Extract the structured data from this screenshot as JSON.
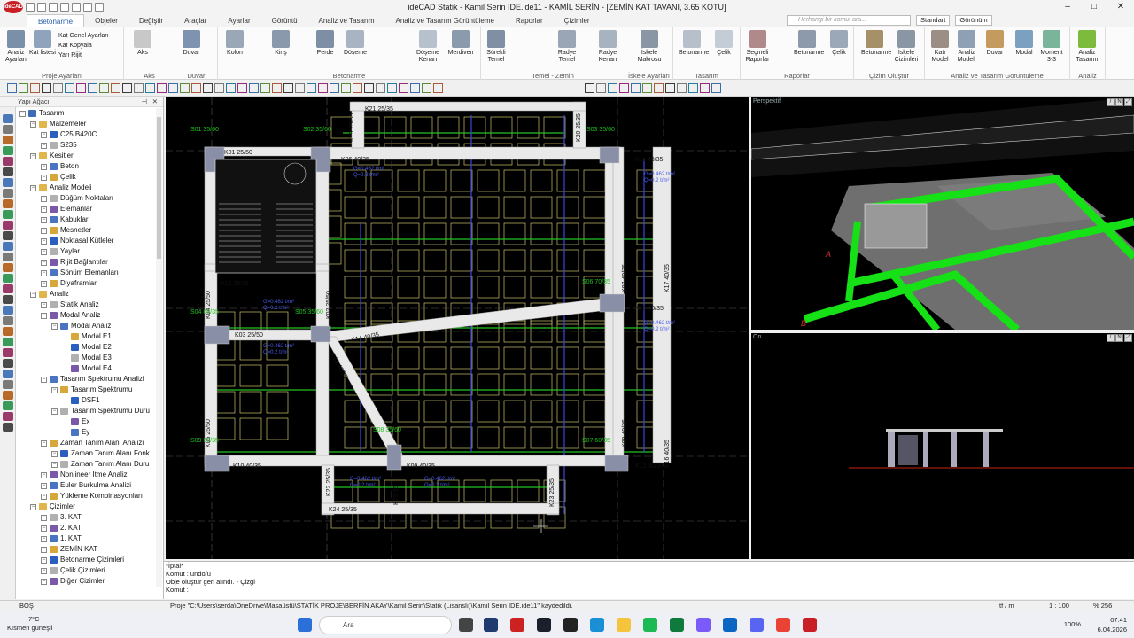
{
  "app": {
    "title": "ideCAD Statik - Kamil Serin IDE.ide11 - KAMİL SERİN - [ZEMİN KAT TAVANI,  3.65 KOTU]",
    "logo": "ideCAD"
  },
  "tabs": [
    "Betonarme",
    "Objeler",
    "Değiştir",
    "Araçlar",
    "Ayarlar",
    "Görüntü",
    "Analiz ve Tasarım",
    "Analiz ve Tasarım Görüntüleme",
    "Raporlar",
    "Çizimler"
  ],
  "command_search": {
    "placeholder": "Herhangi bir komut ara..."
  },
  "tab_right": {
    "standard": "Standart",
    "view": "Görünüm"
  },
  "ribbon": {
    "groups": [
      {
        "label": "Proje Ayarları"
      },
      {
        "label": "Aks"
      },
      {
        "label": "Duvar"
      },
      {
        "label": "Betonarme"
      },
      {
        "label": "Temel - Zemin"
      },
      {
        "label": "İskele Ayarları"
      },
      {
        "label": "Tasarım"
      },
      {
        "label": "Raporlar"
      },
      {
        "label": "Çizim Oluştur"
      },
      {
        "label": "Analiz ve Tasarım Görüntüleme"
      },
      {
        "label": "Analiz"
      }
    ],
    "buttons": [
      {
        "label": "Analiz Ayarları"
      },
      {
        "label": "Kat listesi"
      },
      {
        "label": "Aks"
      },
      {
        "label": "Duvar"
      },
      {
        "label": "Kolon"
      },
      {
        "label": "Kiriş"
      },
      {
        "label": "Perde"
      },
      {
        "label": "Döşeme"
      },
      {
        "label": "Döşeme Kenarı"
      },
      {
        "label": "Merdiven"
      },
      {
        "label": "Sürekli Temel"
      },
      {
        "label": "Radye Temel"
      },
      {
        "label": "Radye Kenarı"
      },
      {
        "label": "İskele Makrosu"
      },
      {
        "label": "Betonarme"
      },
      {
        "label": "Çelik"
      },
      {
        "label": "Seçmeli Raporlar"
      },
      {
        "label": "Betonarme"
      },
      {
        "label": "Çelik"
      },
      {
        "label": "Betonarme"
      },
      {
        "label": "İskele Çizimleri"
      },
      {
        "label": "Katı Model"
      },
      {
        "label": "Analiz Modeli"
      },
      {
        "label": "Duvar"
      },
      {
        "label": "Modal"
      },
      {
        "label": "Moment 3-3"
      },
      {
        "label": "Analiz Tasarım"
      }
    ],
    "small_items": [
      "Kat Genel Ayarları",
      "Kat Kopyala",
      "Yarı Rijit"
    ]
  },
  "tree": {
    "header": "Yapı Ağacı",
    "items": [
      {
        "label": "Tasarım",
        "level": 0
      },
      {
        "label": "Malzemeler",
        "level": 1
      },
      {
        "label": "C25 B420C",
        "level": 2
      },
      {
        "label": "S235",
        "level": 2
      },
      {
        "label": "Kesitler",
        "level": 1
      },
      {
        "label": "Beton",
        "level": 2
      },
      {
        "label": "Çelik",
        "level": 2
      },
      {
        "label": "Analiz Modeli",
        "level": 1
      },
      {
        "label": "Düğüm Noktaları",
        "level": 2
      },
      {
        "label": "Elemanlar",
        "level": 2
      },
      {
        "label": "Kabuklar",
        "level": 2
      },
      {
        "label": "Mesnetler",
        "level": 2
      },
      {
        "label": "Noktasal Kütleler",
        "level": 2
      },
      {
        "label": "Yaylar",
        "level": 2
      },
      {
        "label": "Rijit Bağlantılar",
        "level": 2
      },
      {
        "label": "Sönüm Elemanları",
        "level": 2
      },
      {
        "label": "Diyaframlar",
        "level": 2
      },
      {
        "label": "Analiz",
        "level": 1
      },
      {
        "label": "Statik Analiz",
        "level": 2
      },
      {
        "label": "Modal Analiz",
        "level": 2
      },
      {
        "label": "Modal Analiz",
        "level": 3
      },
      {
        "label": "Modal E1",
        "level": 4
      },
      {
        "label": "Modal E2",
        "level": 4
      },
      {
        "label": "Modal E3",
        "level": 4
      },
      {
        "label": "Modal E4",
        "level": 4
      },
      {
        "label": "Tasarım Spektrumu Analizi",
        "level": 2
      },
      {
        "label": "Tasarım Spektrumu",
        "level": 3
      },
      {
        "label": "DSF1",
        "level": 4
      },
      {
        "label": "Tasarım Spektrumu Duru",
        "level": 3
      },
      {
        "label": "Ex",
        "level": 4
      },
      {
        "label": "Ey",
        "level": 4
      },
      {
        "label": "Zaman Tanım Alanı Analizi",
        "level": 2
      },
      {
        "label": "Zaman Tanım Alanı Fonk",
        "level": 3
      },
      {
        "label": "Zaman Tanım Alanı Duru",
        "level": 3
      },
      {
        "label": "Nonlineer İtme Analizi",
        "level": 2
      },
      {
        "label": "Euler Burkulma Analizi",
        "level": 2
      },
      {
        "label": "Yükleme Kombinasyonları",
        "level": 2
      },
      {
        "label": "Çizimler",
        "level": 1
      },
      {
        "label": "3. KAT",
        "level": 2
      },
      {
        "label": "2. KAT",
        "level": 2
      },
      {
        "label": "1. KAT",
        "level": 2
      },
      {
        "label": "ZEMİN KAT",
        "level": 2
      },
      {
        "label": "Betonarme Çizimleri",
        "level": 2
      },
      {
        "label": "Çelik Çizimleri",
        "level": 2
      },
      {
        "label": "Diğer Çizimler",
        "level": 2
      }
    ]
  },
  "plan_labels": {
    "beams": [
      "K21 25/35",
      "K19 25/35",
      "K20 25/35",
      "K01 25/50",
      "K06 40/35",
      "K11 40/35",
      "K18 25/35",
      "K07 40/35",
      "K17 40/35",
      "K15 40/35",
      "K03 25/50",
      "K14 40/35",
      "K13 40/35",
      "K02 25/50",
      "K04 25/50",
      "K05 25/50",
      "K08 40/35",
      "K16 40/35",
      "K10 40/35",
      "K09 40/35",
      "K12 40/35",
      "K22 25/35",
      "K23 25/35",
      "K24 25/35",
      "K25 35"
    ],
    "columns": [
      "S01 35/60",
      "S02 35/60",
      "S03 35/60",
      "S04 60/35",
      "S05 35/60",
      "S06 70/35",
      "S08 35/60",
      "S07 60/35",
      "S09 60/35"
    ],
    "loads": [
      "G=0.462 t/m²",
      "Q=0.2 t/m²"
    ]
  },
  "viewports": {
    "perspective": "Perspektif",
    "front": "Ön",
    "persp_letters": [
      "A",
      "B"
    ]
  },
  "command_log": [
    "*İptal*",
    "Komut : undo/u",
    "Obje oluştur geri alındı. - Çizgi",
    "Komut :"
  ],
  "status_bar": {
    "left": "BOŞ",
    "message": "Proje \"C:\\Users\\serda\\OneDrive\\Masaüstü\\STATİK PROJE\\BERFİN AKAY\\Kamil Serin\\Statik (Lisanslı)\\Kamil Serin IDE.ide11\" kaydedildi.",
    "unit": "tf / m",
    "scale": "1 : 100",
    "zoom": "% 256"
  },
  "taskbar": {
    "weather_temp": "7°C",
    "weather_text": "Kısmen güneşli",
    "search": "Ara",
    "battery": "100%",
    "time": "07:41",
    "date": "6.04.2026"
  },
  "colors": {
    "accent": "#2a5ea8",
    "beam": "#e9e9e9",
    "slab_grid": "#c9c36a",
    "green_line": "#22c322",
    "blue_line": "#3a48d8"
  }
}
